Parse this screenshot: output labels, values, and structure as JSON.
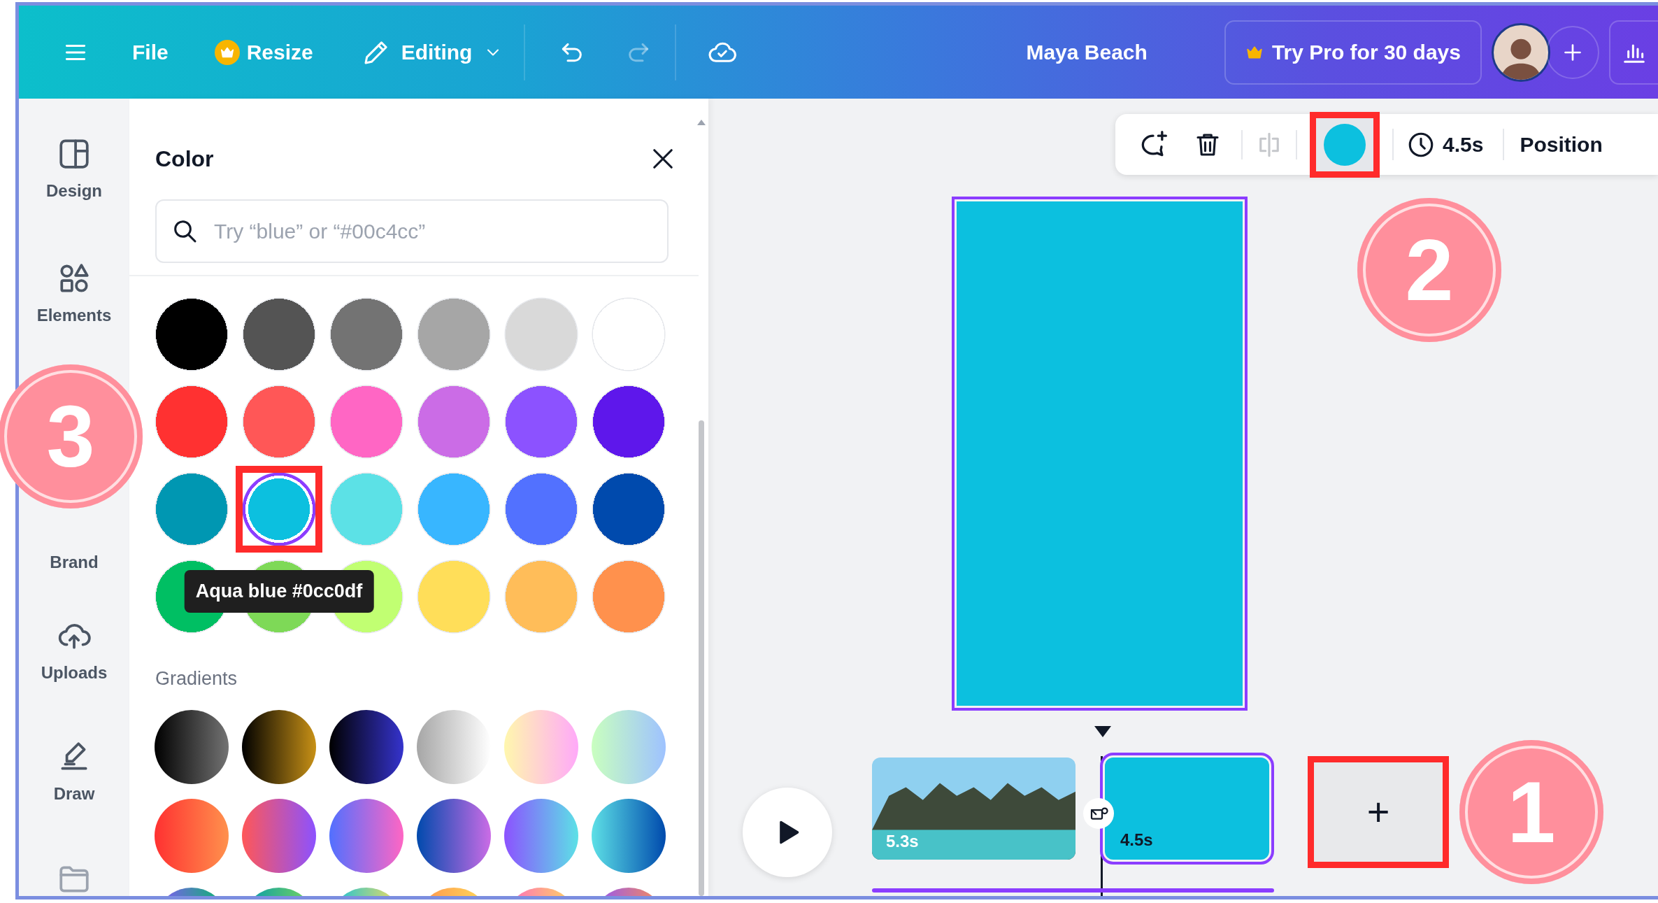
{
  "top_bar": {
    "items": [
      {
        "kind": "menu"
      },
      {
        "kind": "text",
        "label": "File"
      },
      {
        "kind": "crown",
        "label": "Resize"
      },
      {
        "kind": "editing",
        "label": "Editing"
      },
      {
        "kind": "undo",
        "disabled": false
      },
      {
        "kind": "redo",
        "disabled": true
      },
      {
        "kind": "cloud"
      }
    ],
    "title": "Maya Beach",
    "pro_button": "Try Pro for 30 days"
  },
  "sidebar": {
    "items": [
      {
        "kind": "design",
        "label": "Design"
      },
      {
        "kind": "elements",
        "label": "Elements"
      },
      {
        "kind": "brand",
        "label": "Brand"
      },
      {
        "kind": "uploads",
        "label": "Uploads"
      },
      {
        "kind": "draw",
        "label": "Draw"
      },
      {
        "kind": "folder"
      }
    ]
  },
  "color_panel": {
    "title": "Color",
    "search": {
      "placeholder": "Try “blue” or “#00c4cc”"
    },
    "swatches": [
      {
        "color": "#000000",
        "selected": false,
        "highlighted": false
      },
      {
        "color": "#545454",
        "selected": false,
        "highlighted": false
      },
      {
        "color": "#737373",
        "selected": false,
        "highlighted": false
      },
      {
        "color": "#a6a6a6",
        "selected": false,
        "highlighted": false
      },
      {
        "color": "#d9d9d9",
        "selected": false,
        "highlighted": false
      },
      {
        "color": "#ffffff",
        "selected": false,
        "highlighted": false
      },
      {
        "color": "#ff3131",
        "selected": false,
        "highlighted": false
      },
      {
        "color": "#ff5757",
        "selected": false,
        "highlighted": false
      },
      {
        "color": "#ff66c4",
        "selected": false,
        "highlighted": false
      },
      {
        "color": "#cb6ce6",
        "selected": false,
        "highlighted": false
      },
      {
        "color": "#8c52ff",
        "selected": false,
        "highlighted": false
      },
      {
        "color": "#5e17eb",
        "selected": false,
        "highlighted": false
      },
      {
        "color": "#0097b2",
        "selected": false,
        "highlighted": false
      },
      {
        "color": "#0cc0df",
        "selected": true,
        "highlighted": true
      },
      {
        "color": "#5ce1e6",
        "selected": false,
        "highlighted": false
      },
      {
        "color": "#38b6ff",
        "selected": false,
        "highlighted": false
      },
      {
        "color": "#5271ff",
        "selected": false,
        "highlighted": false
      },
      {
        "color": "#004aad",
        "selected": false,
        "highlighted": false
      },
      {
        "color": "#00bf63",
        "selected": false,
        "highlighted": false
      },
      {
        "color": "#7ed957",
        "selected": false,
        "highlighted": false
      },
      {
        "color": "#c1ff72",
        "selected": false,
        "highlighted": false
      },
      {
        "color": "#ffde59",
        "selected": false,
        "highlighted": false
      },
      {
        "color": "#ffbd59",
        "selected": false,
        "highlighted": false
      },
      {
        "color": "#ff914d",
        "selected": false,
        "highlighted": false
      }
    ],
    "tooltip": "Aqua blue #0cc0df",
    "gradients_label": "Gradients"
  },
  "toolbar": {
    "items": [
      {
        "kind": "comment"
      },
      {
        "kind": "delete"
      },
      {
        "kind": "flip",
        "disabled": true
      },
      {
        "kind": "color",
        "color": "#0cc0df",
        "highlighted": true
      },
      {
        "kind": "duration",
        "label": "4.5s"
      },
      {
        "kind": "text",
        "label": "Position"
      }
    ]
  },
  "canvas": {
    "color": "#0cc0df",
    "selected": true
  },
  "timeline": {
    "clips": [
      {
        "kind": "video",
        "duration": "5.3s",
        "selected": false
      },
      {
        "kind": "color",
        "duration": "4.5s",
        "color": "#0cc0df",
        "selected": true
      }
    ],
    "add_button": {
      "label": "+",
      "highlighted": true
    }
  },
  "markers": [
    {
      "label": "1"
    },
    {
      "label": "2"
    },
    {
      "label": "3"
    }
  ]
}
